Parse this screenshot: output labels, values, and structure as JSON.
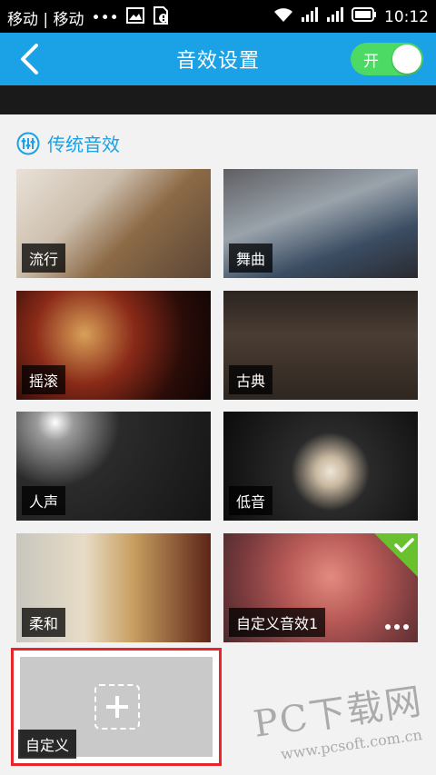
{
  "status_bar": {
    "carriers": "移动 | 移动",
    "dots": "•••",
    "time": "10:12"
  },
  "header": {
    "title": "音效设置",
    "toggle_label": "开",
    "toggle_on": true
  },
  "section": {
    "title": "传统音效"
  },
  "presets": [
    {
      "label": "流行"
    },
    {
      "label": "舞曲"
    },
    {
      "label": "摇滚"
    },
    {
      "label": "古典"
    },
    {
      "label": "人声"
    },
    {
      "label": "低音"
    },
    {
      "label": "柔和"
    },
    {
      "label": "自定义音效1",
      "selected": true
    }
  ],
  "custom_add": {
    "label": "自定义"
  },
  "watermark": {
    "brand": "PC下载网",
    "url": "www.pcsoft.com.cn"
  },
  "colors": {
    "header": "#1ba1e6",
    "toggle": "#4cd964",
    "selected_check": "#6ac12f",
    "highlight_border": "#e8252b"
  }
}
